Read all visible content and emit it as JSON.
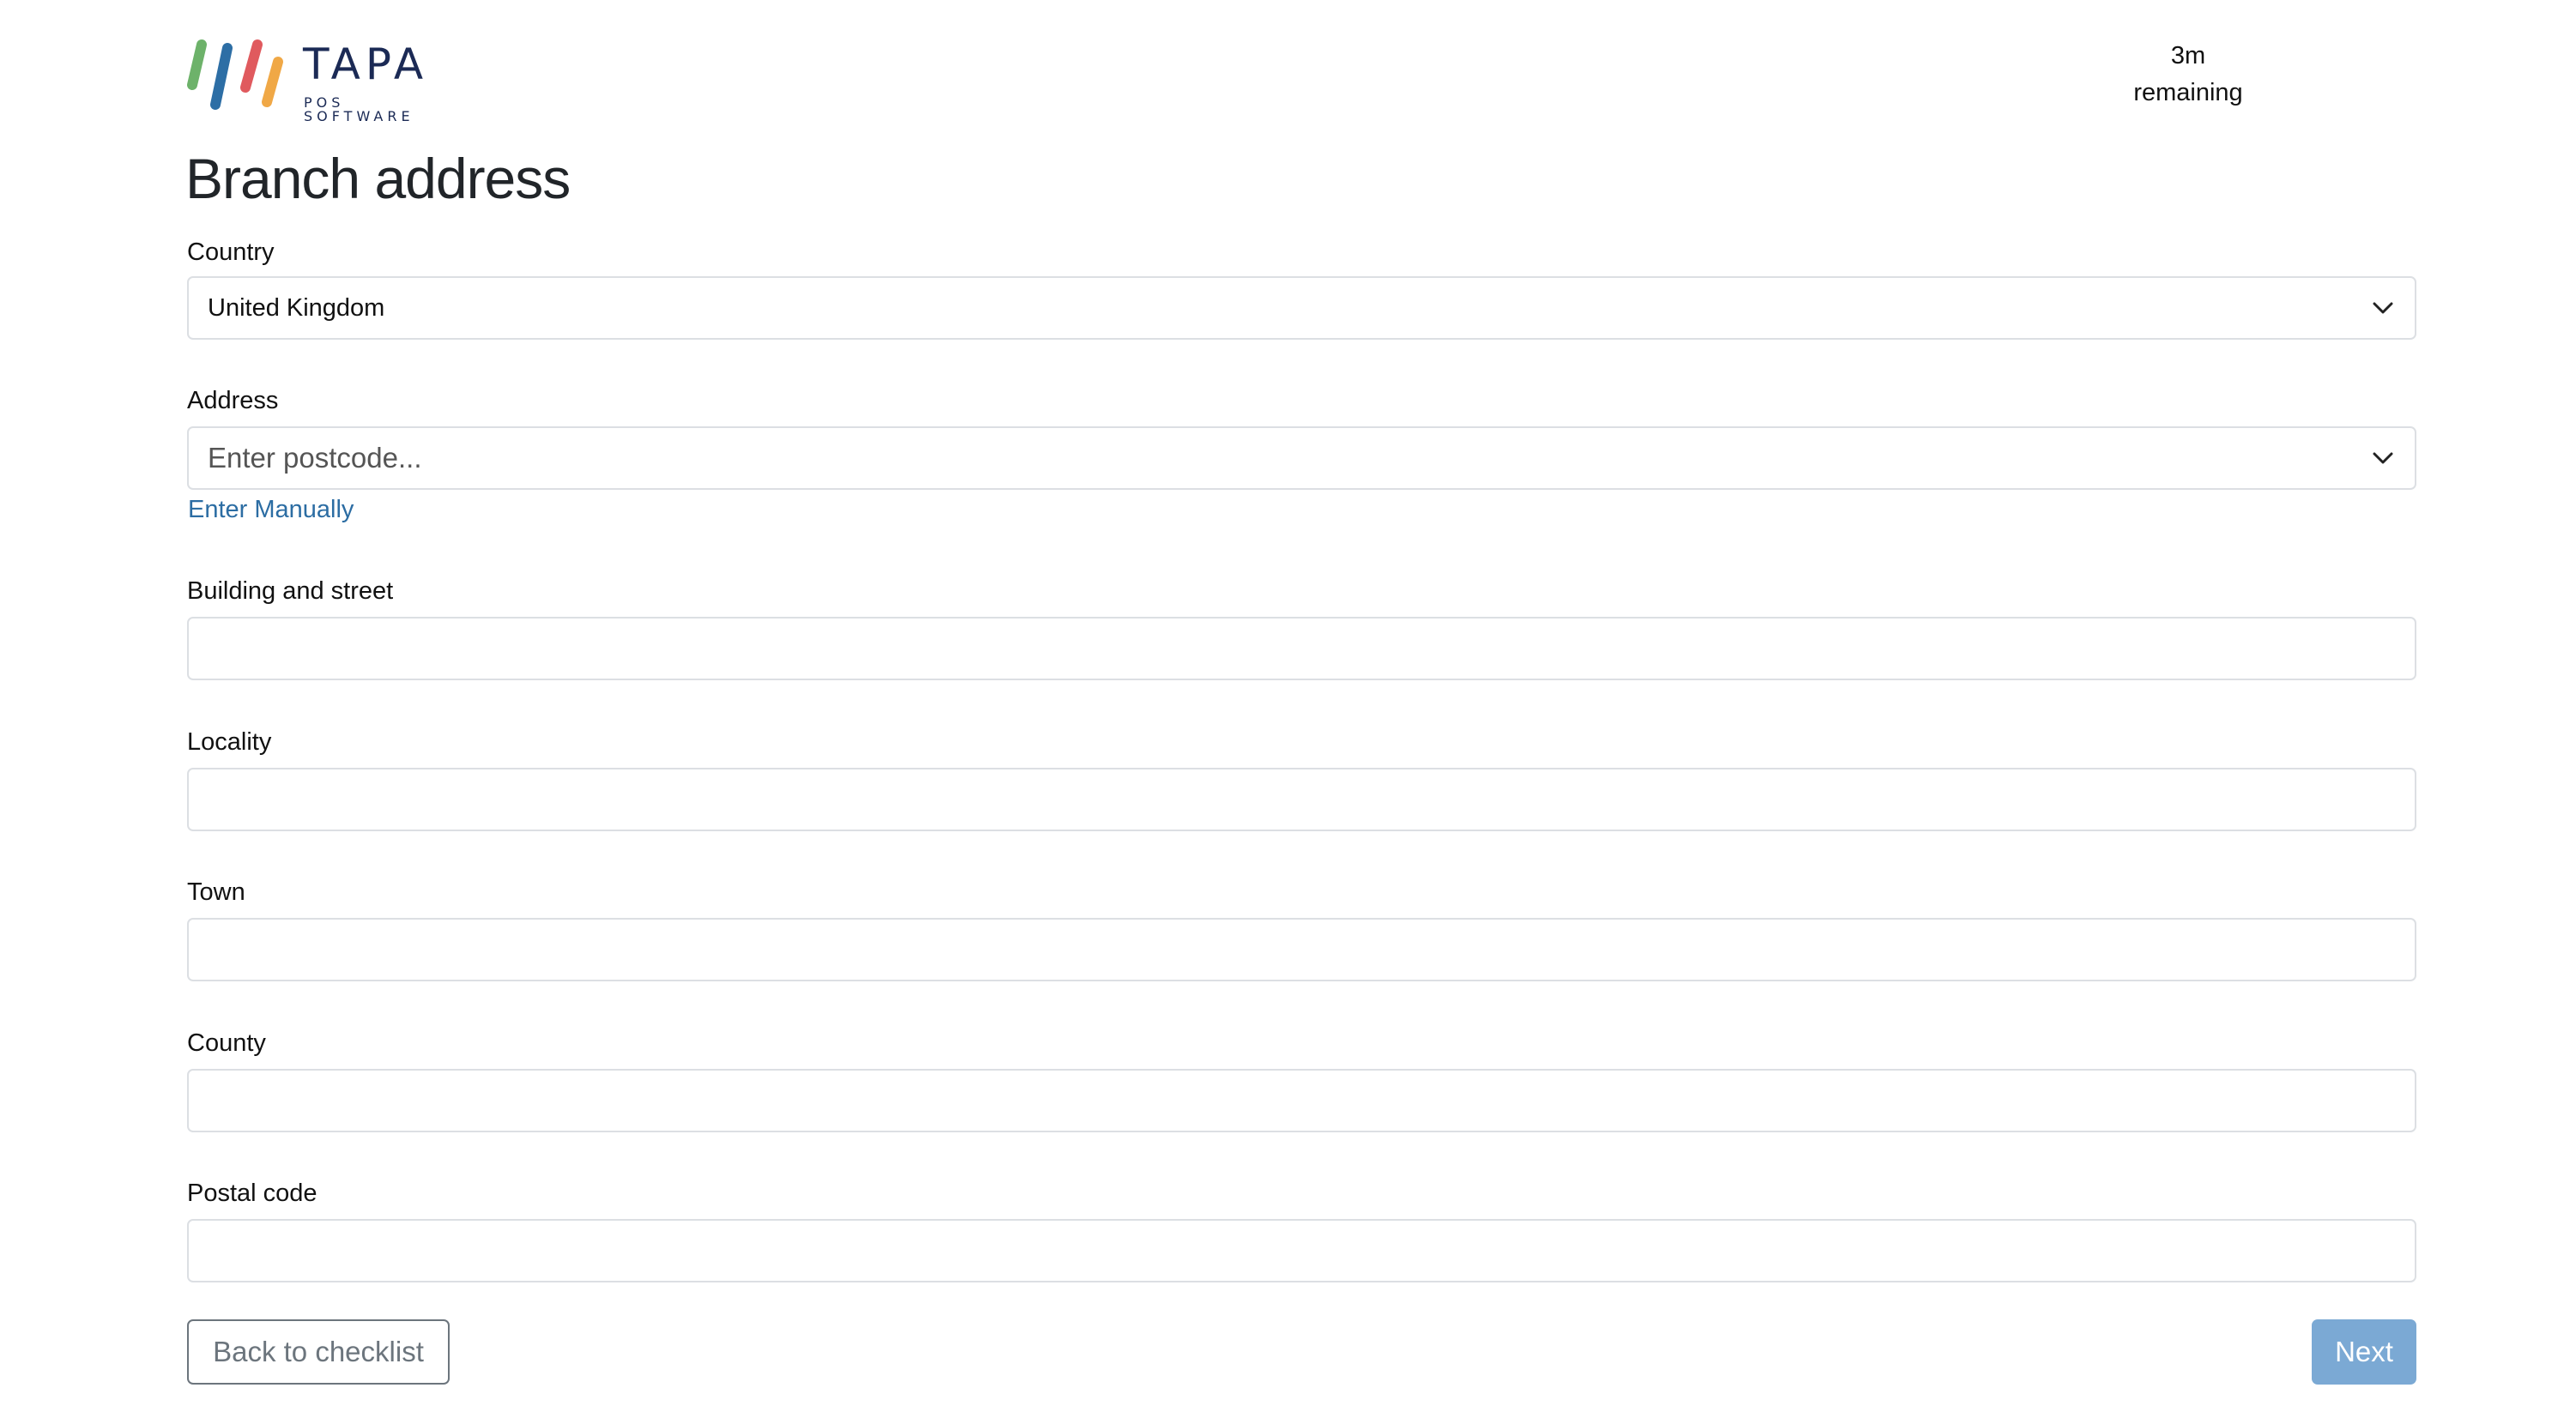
{
  "header": {
    "brand_name": "TAPA",
    "brand_subtitle": "POS SOFTWARE",
    "timer_value": "3m",
    "timer_label": "remaining"
  },
  "page": {
    "title": "Branch address"
  },
  "form": {
    "country": {
      "label": "Country",
      "value": "United Kingdom"
    },
    "address": {
      "label": "Address",
      "placeholder": "Enter postcode...",
      "manual_link": "Enter Manually"
    },
    "building_street": {
      "label": "Building and street",
      "value": ""
    },
    "locality": {
      "label": "Locality",
      "value": ""
    },
    "town": {
      "label": "Town",
      "value": ""
    },
    "county": {
      "label": "County",
      "value": ""
    },
    "postal_code": {
      "label": "Postal code",
      "value": ""
    }
  },
  "actions": {
    "back_label": "Back to checklist",
    "next_label": "Next"
  },
  "colors": {
    "logo_stripes": [
      "#6db26a",
      "#2d6ea5",
      "#e05a5e",
      "#f0a846"
    ],
    "brand": "#1b2a55",
    "link": "#2c6da3",
    "next_button": "#7ba9d4"
  },
  "icons": [
    "chevron-down-icon"
  ]
}
